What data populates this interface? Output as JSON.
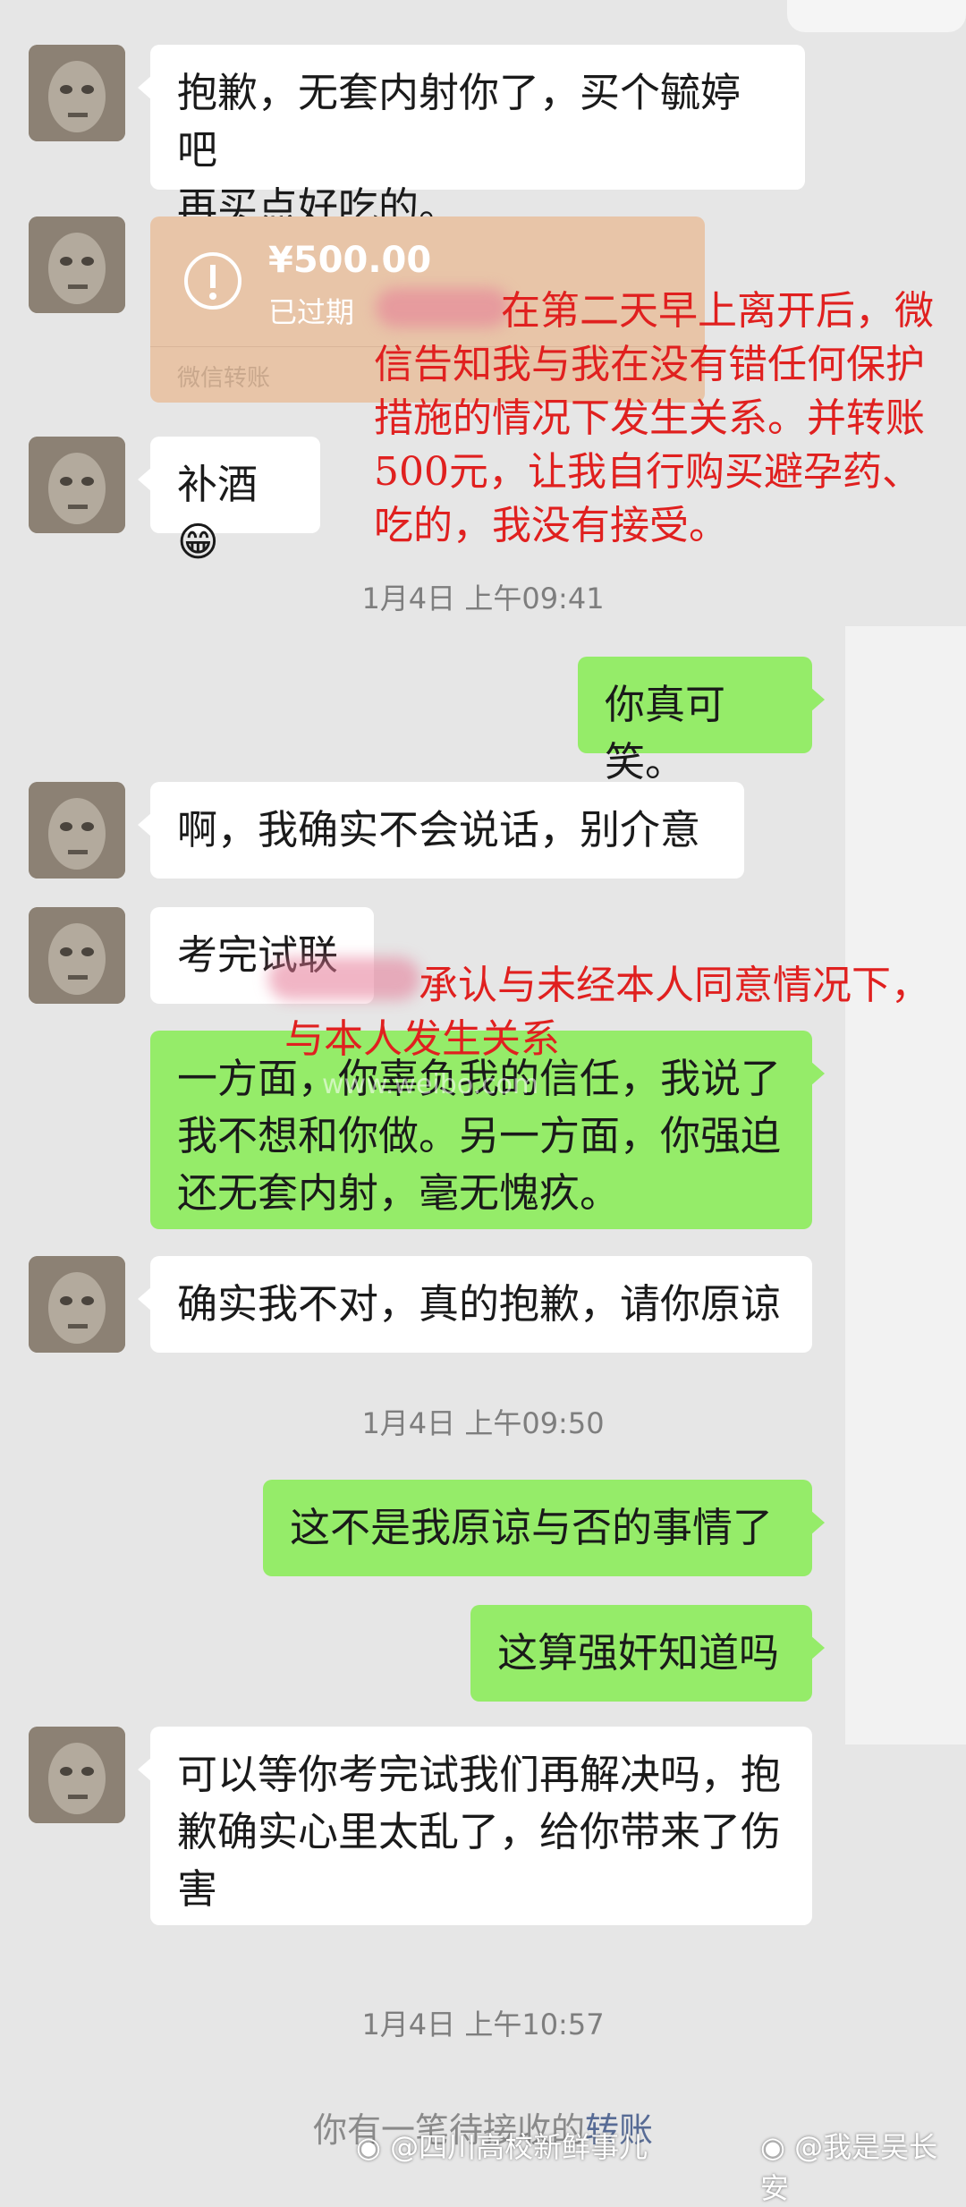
{
  "messages": [
    {
      "side": "in",
      "text_lines": [
        "抱歉，无套内射你了，买个毓婷吧",
        "再买点好吃的。"
      ]
    },
    {
      "side": "in",
      "type": "transfer",
      "amount": "¥500.00",
      "status": "已过期",
      "footer": "微信转账"
    },
    {
      "side": "in",
      "text": "补酒",
      "emoji": "😁"
    },
    {
      "type": "time",
      "text": "1月4日 上午09:41"
    },
    {
      "side": "out",
      "text": "你真可笑。"
    },
    {
      "side": "in",
      "text": "啊，我确实不会说话，别介意"
    },
    {
      "side": "in",
      "text": "考完试联"
    },
    {
      "side": "out",
      "text_lines": [
        "一方面，你辜负我的信任，我说了",
        "我不想和你做。另一方面，你强迫",
        "还无套内射，毫无愧疚。"
      ]
    },
    {
      "side": "in",
      "text": "确实我不对，真的抱歉，请你原谅"
    },
    {
      "type": "time",
      "text": "1月4日 上午09:50"
    },
    {
      "side": "out",
      "text": "这不是我原谅与否的事情了"
    },
    {
      "side": "out",
      "text": "这算强奸知道吗"
    },
    {
      "side": "in",
      "text_lines": [
        "可以等你考完试我们再解决吗，抱",
        "歉确实心里太乱了，给你带来了伤",
        "害"
      ]
    },
    {
      "type": "time",
      "text": "1月4日 上午10:57"
    }
  ],
  "annotations": {
    "first_lines": [
      "在第二天早上离开后，微",
      "信告知我与我在没有错任何保护",
      "措施的情况下发生关系。并转账",
      "500元，让我自行购买避孕药、",
      "吃的，我没有接受。"
    ],
    "second_lines": [
      "承认与未经本人同意情况下，",
      "与本人发生关系"
    ]
  },
  "pending_notice": {
    "prefix": "你有一笔待接收的",
    "link": "转账"
  },
  "watermarks": {
    "left": "@四川高校新鲜事儿",
    "right": "@我是吴长安",
    "center": "www.weibo.com"
  },
  "colors": {
    "background": "#e6e6e6",
    "incoming_bubble": "#ffffff",
    "outgoing_bubble": "#95ec69",
    "annotation": "#e0201f",
    "link": "#576b95"
  }
}
